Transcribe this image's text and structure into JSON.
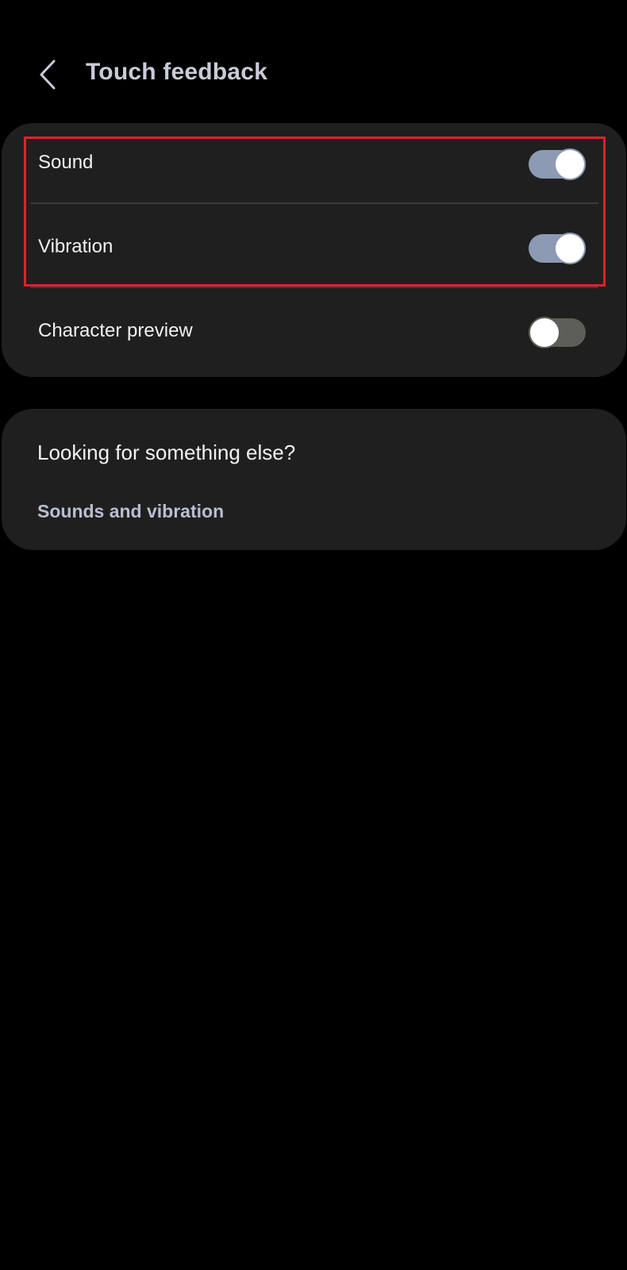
{
  "header": {
    "title": "Touch feedback",
    "back_icon": "chevron-left-icon"
  },
  "settings": {
    "items": [
      {
        "label": "Sound",
        "enabled": true
      },
      {
        "label": "Vibration",
        "enabled": true
      },
      {
        "label": "Character preview",
        "enabled": false
      }
    ]
  },
  "suggestions": {
    "title": "Looking for something else?",
    "link": "Sounds and vibration"
  },
  "colors": {
    "background": "#000000",
    "card": "#1f1f1f",
    "toggle_on": "#8d9ab3",
    "toggle_off": "#5e5e58",
    "highlight": "#e0202e",
    "title_text": "#c9cbd6",
    "link_text": "#b8bfd0"
  }
}
